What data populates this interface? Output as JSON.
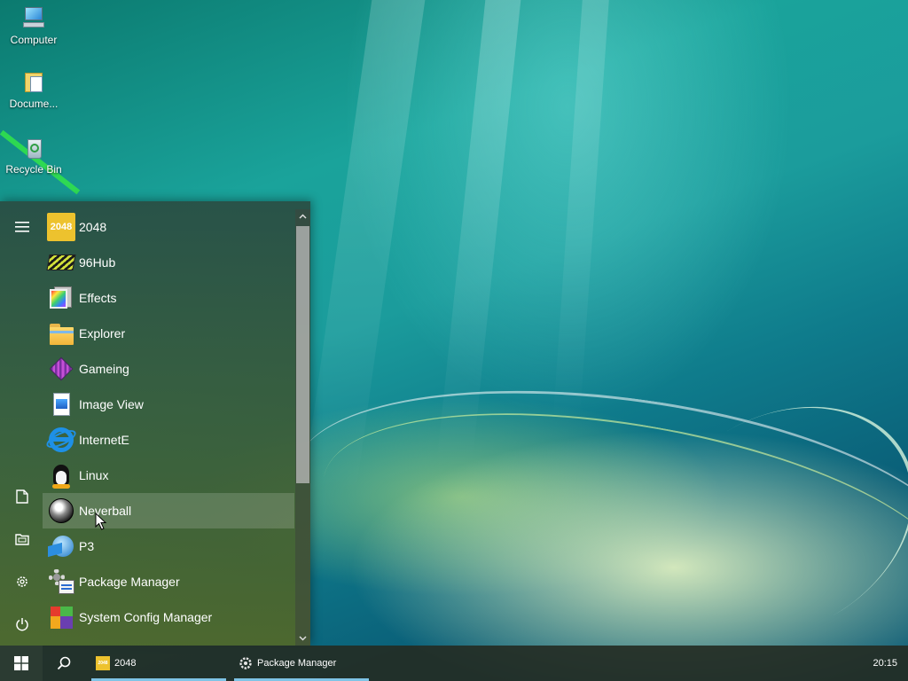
{
  "desktop": {
    "icons": [
      {
        "label": "Computer",
        "icon": "computer-icon"
      },
      {
        "label": "Docume...",
        "icon": "documents-icon"
      },
      {
        "label": "Recycle Bin",
        "icon": "recycle-bin-icon"
      }
    ]
  },
  "start_menu": {
    "rail": {
      "menu": "hamburger-icon",
      "documents": "document-icon",
      "pictures": "pictures-folder-icon",
      "settings": "gear-icon",
      "power": "power-icon"
    },
    "apps": [
      {
        "label": "2048",
        "icon": "2048-icon",
        "badge": "2048"
      },
      {
        "label": "96Hub",
        "icon": "96hub-icon"
      },
      {
        "label": "Effects",
        "icon": "effects-icon"
      },
      {
        "label": "Explorer",
        "icon": "folder-icon"
      },
      {
        "label": "Gameing",
        "icon": "cube-icon"
      },
      {
        "label": "Image View",
        "icon": "image-icon"
      },
      {
        "label": "InternetE",
        "icon": "internet-explorer-icon"
      },
      {
        "label": "Linux",
        "icon": "tux-penguin-icon"
      },
      {
        "label": "Neverball",
        "icon": "ball-icon"
      },
      {
        "label": "P3",
        "icon": "globe-icon"
      },
      {
        "label": "Package Manager",
        "icon": "package-manager-icon"
      },
      {
        "label": "System Config Manager",
        "icon": "system-config-icon"
      }
    ],
    "hovered": "Neverball"
  },
  "taskbar": {
    "tasks": [
      {
        "label": "2048",
        "badge": "2048",
        "icon": "2048-icon"
      },
      {
        "label": "Package Manager",
        "icon": "gear-icon"
      }
    ],
    "clock": "20:15"
  },
  "colors": {
    "accent": "#7fc4e6",
    "tile_2048": "#edc22e"
  }
}
